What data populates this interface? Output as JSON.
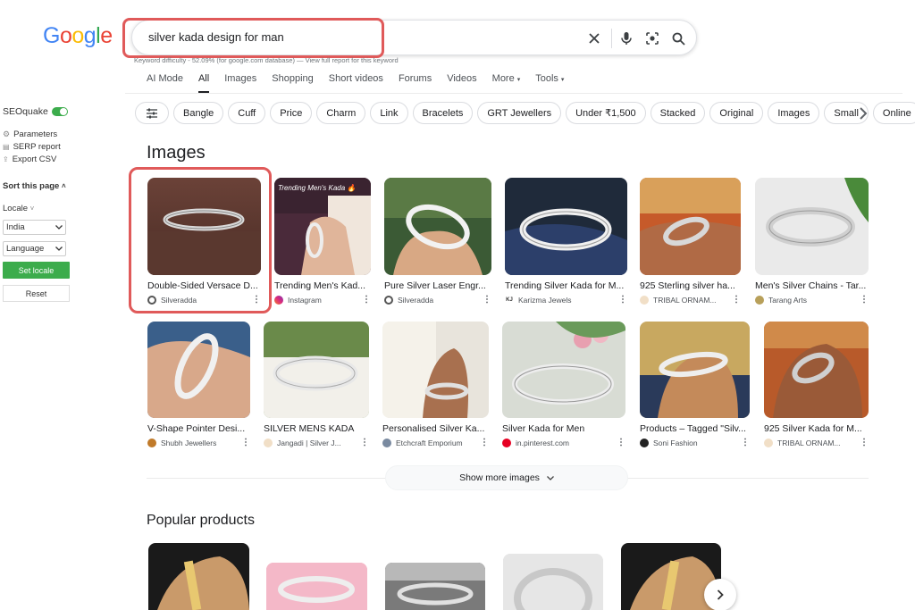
{
  "search": {
    "query": "silver kada design for man",
    "seo_meta": "Keyword difficulty - 52.09% (for google.com database) — View full report for this keyword"
  },
  "logo": {
    "letters": [
      "G",
      "o",
      "o",
      "g",
      "l",
      "e"
    ],
    "colors": [
      "#4285F4",
      "#EA4335",
      "#FBBC05",
      "#4285F4",
      "#34A853",
      "#EA4335"
    ]
  },
  "tabs": [
    {
      "label": "AI Mode"
    },
    {
      "label": "All",
      "active": true
    },
    {
      "label": "Images"
    },
    {
      "label": "Shopping"
    },
    {
      "label": "Short videos"
    },
    {
      "label": "Forums"
    },
    {
      "label": "Videos"
    },
    {
      "label": "More",
      "caret": "▾"
    },
    {
      "label": "Tools",
      "caret": "▾"
    }
  ],
  "chips": [
    "Bangle",
    "Cuff",
    "Price",
    "Charm",
    "Link",
    "Bracelets",
    "GRT Jewellers",
    "Under ₹1,500",
    "Stacked",
    "Original",
    "Images",
    "Small",
    "Online"
  ],
  "seoquake": {
    "title": "SEOquake",
    "links": [
      "Parameters",
      "SERP report",
      "Export CSV"
    ],
    "sort_label": "Sort this page",
    "locale_label": "Locale",
    "country": "India",
    "language": "Language",
    "set_locale": "Set locale",
    "reset": "Reset"
  },
  "images_section": {
    "title": "Images",
    "row1": [
      {
        "title": "Double-Sided Versace D...",
        "source": "Silveradda",
        "icon_color": "#555555"
      },
      {
        "title": "Trending Men's Kad...",
        "source": "Instagram",
        "icon_color": "#c13584",
        "overlay": "Trending Men's Kada 🔥"
      },
      {
        "title": "Pure Silver Laser Engr...",
        "source": "Silveradda",
        "icon_color": "#555555"
      },
      {
        "title": "Trending Silver Kada for M...",
        "source": "Karizma Jewels",
        "icon_color": "#333333",
        "icon_text": "KJ"
      },
      {
        "title": "925 Sterling silver ha...",
        "source": "TRIBAL ORNAM...",
        "icon_color": "#f1dfc7"
      },
      {
        "title": "Men's Silver Chains - Tar...",
        "source": "Tarang Arts",
        "icon_color": "#b8a05a"
      }
    ],
    "row2": [
      {
        "title": "V-Shape Pointer Desi...",
        "source": "Shubh Jewellers",
        "icon_color": "#c07a2a"
      },
      {
        "title": "SILVER MENS KADA",
        "source": "Jangadi | Silver J...",
        "icon_color": "#f1dfc7"
      },
      {
        "title": "Personalised Silver Ka...",
        "source": "Etchcraft Emporium",
        "icon_color": "#7a8aa0"
      },
      {
        "title": "Silver Kada for Men",
        "source": "in.pinterest.com",
        "icon_color": "#e60023"
      },
      {
        "title": "Products – Tagged \"Silv...",
        "source": "Soni Fashion",
        "icon_color": "#222222"
      },
      {
        "title": "925 Silver Kada for M...",
        "source": "TRIBAL ORNAM...",
        "icon_color": "#f1dfc7"
      }
    ],
    "show_more": "Show more images"
  },
  "popular": {
    "title": "Popular products"
  }
}
